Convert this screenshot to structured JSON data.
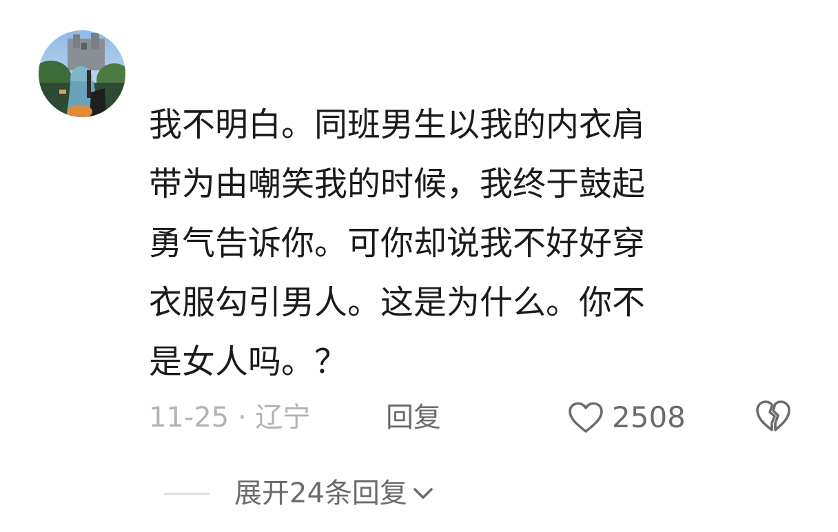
{
  "comment": {
    "avatar_icon": "user-avatar-photo",
    "lines": [
      "我不明白。同班男生以我的内衣肩",
      "带为由嘲笑我的时候，我终于鼓起",
      "勇气告诉你。可你却说我不好好穿",
      "衣服勾引男人。这是为什么。你不",
      "是女人吗。？"
    ],
    "meta": "11-25 · 辽宁",
    "reply_label": "回复",
    "like_icon": "heart-outline-icon",
    "like_count": "2508",
    "dislike_icon": "broken-heart-icon"
  },
  "replies": {
    "expand_label": "展开24条回复",
    "expand_icon": "chevron-down-icon"
  },
  "colors": {
    "text_primary": "#1b1b1b",
    "text_secondary": "#6b6b6b",
    "text_muted": "#b3b3b3",
    "divider": "#dedede",
    "background": "#ffffff"
  }
}
